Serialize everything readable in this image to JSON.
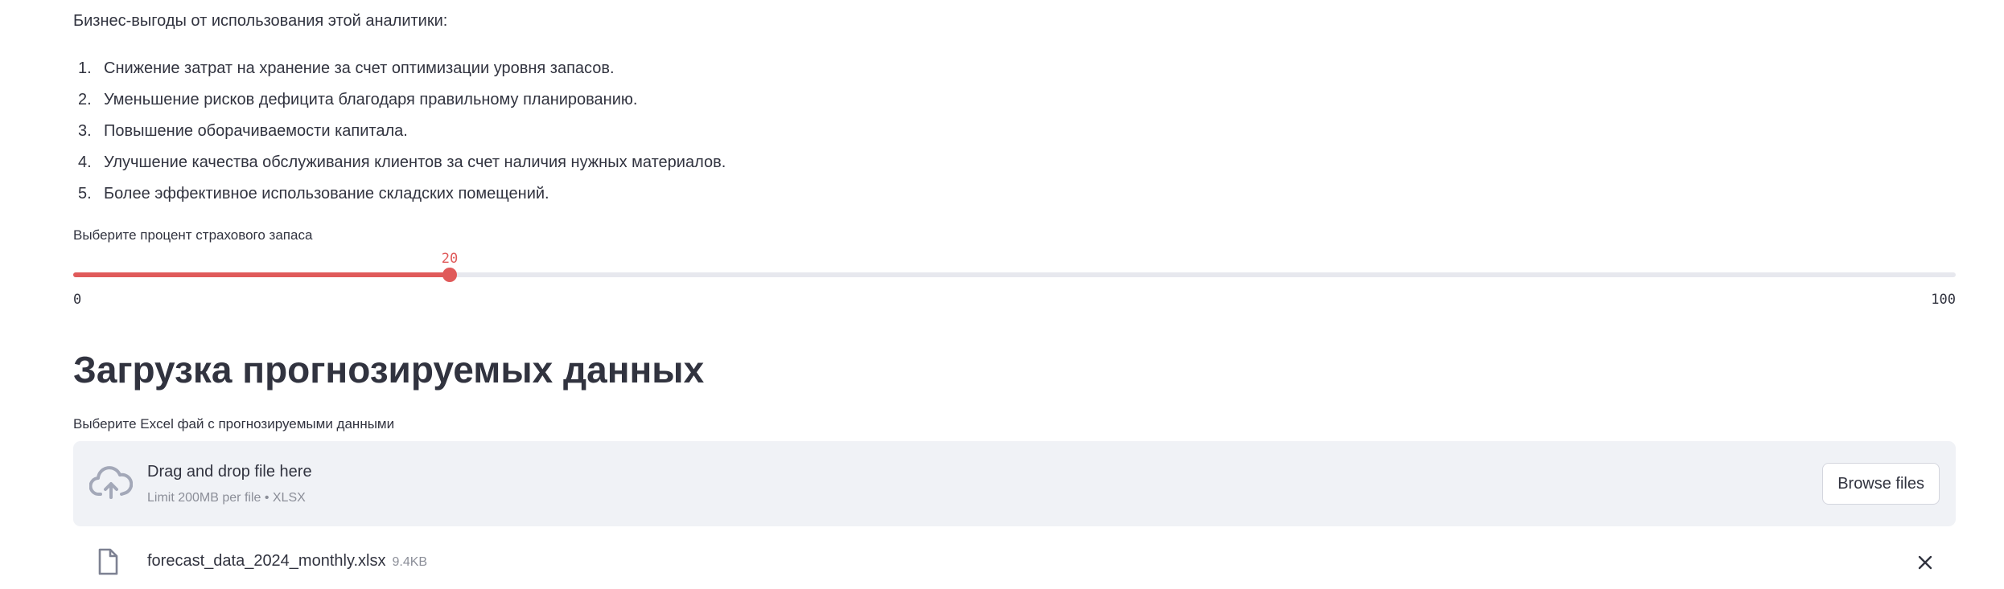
{
  "intro": {
    "text": "Бизнес-выгоды от использования этой аналитики:"
  },
  "benefits": [
    {
      "num": "1.",
      "text": "Снижение затрат на хранение за счет оптимизации уровня запасов."
    },
    {
      "num": "2.",
      "text": "Уменьшение рисков дефицита благодаря правильному планированию."
    },
    {
      "num": "3.",
      "text": "Повышение оборачиваемости капитала."
    },
    {
      "num": "4.",
      "text": "Улучшение качества обслуживания клиентов за счет наличия нужных материалов."
    },
    {
      "num": "5.",
      "text": "Более эффективное использование складских помещений."
    }
  ],
  "slider": {
    "label": "Выберите процент страхового запаса",
    "value": "20",
    "min": "0",
    "max": "100",
    "accent_color": "#e05a5a"
  },
  "section": {
    "title": "Загрузка прогнозируемых данных"
  },
  "uploader": {
    "label": "Выберите Excel фай с прогнозируемыми данными",
    "dropzone_title": "Drag and drop file here",
    "dropzone_hint": "Limit 200MB per file • XLSX",
    "browse_label": "Browse files",
    "icon": "cloud-upload-icon"
  },
  "file": {
    "name": "forecast_data_2024_monthly.xlsx",
    "size": "9.4KB",
    "icon": "file-icon",
    "remove_icon": "close-icon"
  }
}
